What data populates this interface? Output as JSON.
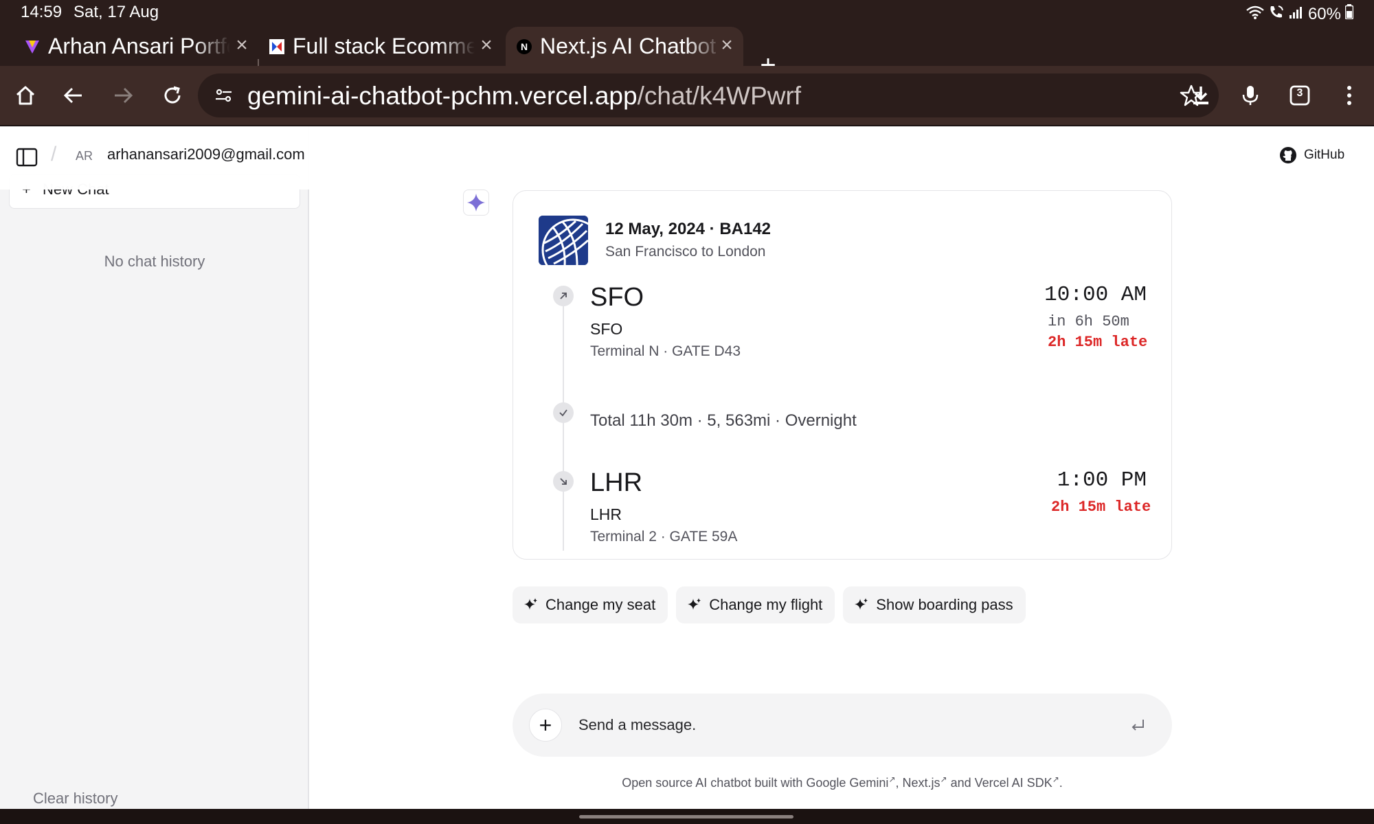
{
  "status_bar": {
    "time": "14:59",
    "date": "Sat, 17 Aug",
    "battery": "60%"
  },
  "tabs": [
    {
      "title": "Arhan Ansari Portfolio",
      "active": false
    },
    {
      "title": "Full stack Ecommerce",
      "active": false
    },
    {
      "title": "Next.js AI Chatbot",
      "active": true
    }
  ],
  "omnibox": {
    "host": "gemini-ai-chatbot-pchm.vercel.app",
    "path": "/chat/k4WPwrf"
  },
  "toolbar": {
    "tab_count": "3"
  },
  "header": {
    "initials": "AR",
    "email": "arhanansari2009@gmail.com",
    "github_label": "GitHub"
  },
  "sidebar": {
    "new_chat_label": "New Chat",
    "empty_label": "No chat history",
    "clear_label": "Clear history"
  },
  "flight": {
    "date_flight": "12 May, 2024 · BA142",
    "route": "San Francisco to London",
    "departure": {
      "code": "SFO",
      "name": "SFO",
      "gate_info": "Terminal N · GATE D43",
      "time": "10:00 AM",
      "countdown": "in 6h 50m",
      "delay": "2h 15m late"
    },
    "total": "Total 11h 30m · 5, 563mi · Overnight",
    "arrival": {
      "code": "LHR",
      "name": "LHR",
      "gate_info": "Terminal 2 · GATE 59A",
      "time": "1:00 PM",
      "delay": "2h 15m late"
    }
  },
  "suggestions": [
    "Change my seat",
    "Change my flight",
    "Show boarding pass"
  ],
  "composer": {
    "placeholder": "Send a message."
  },
  "footer": {
    "prefix": "Open source AI chatbot built with ",
    "link1": "Google Gemini",
    "sep1": ", ",
    "link2": "Next.js",
    "sep2": " and ",
    "link3": "Vercel AI SDK",
    "suffix": "."
  },
  "colors": {
    "browser_chrome": "#3e2b27",
    "status_bar": "#2b1d1b",
    "delay_red": "#dc2626",
    "sparkle_purple": "#7c6fd6",
    "airline_blue": "#1e3a8a"
  }
}
